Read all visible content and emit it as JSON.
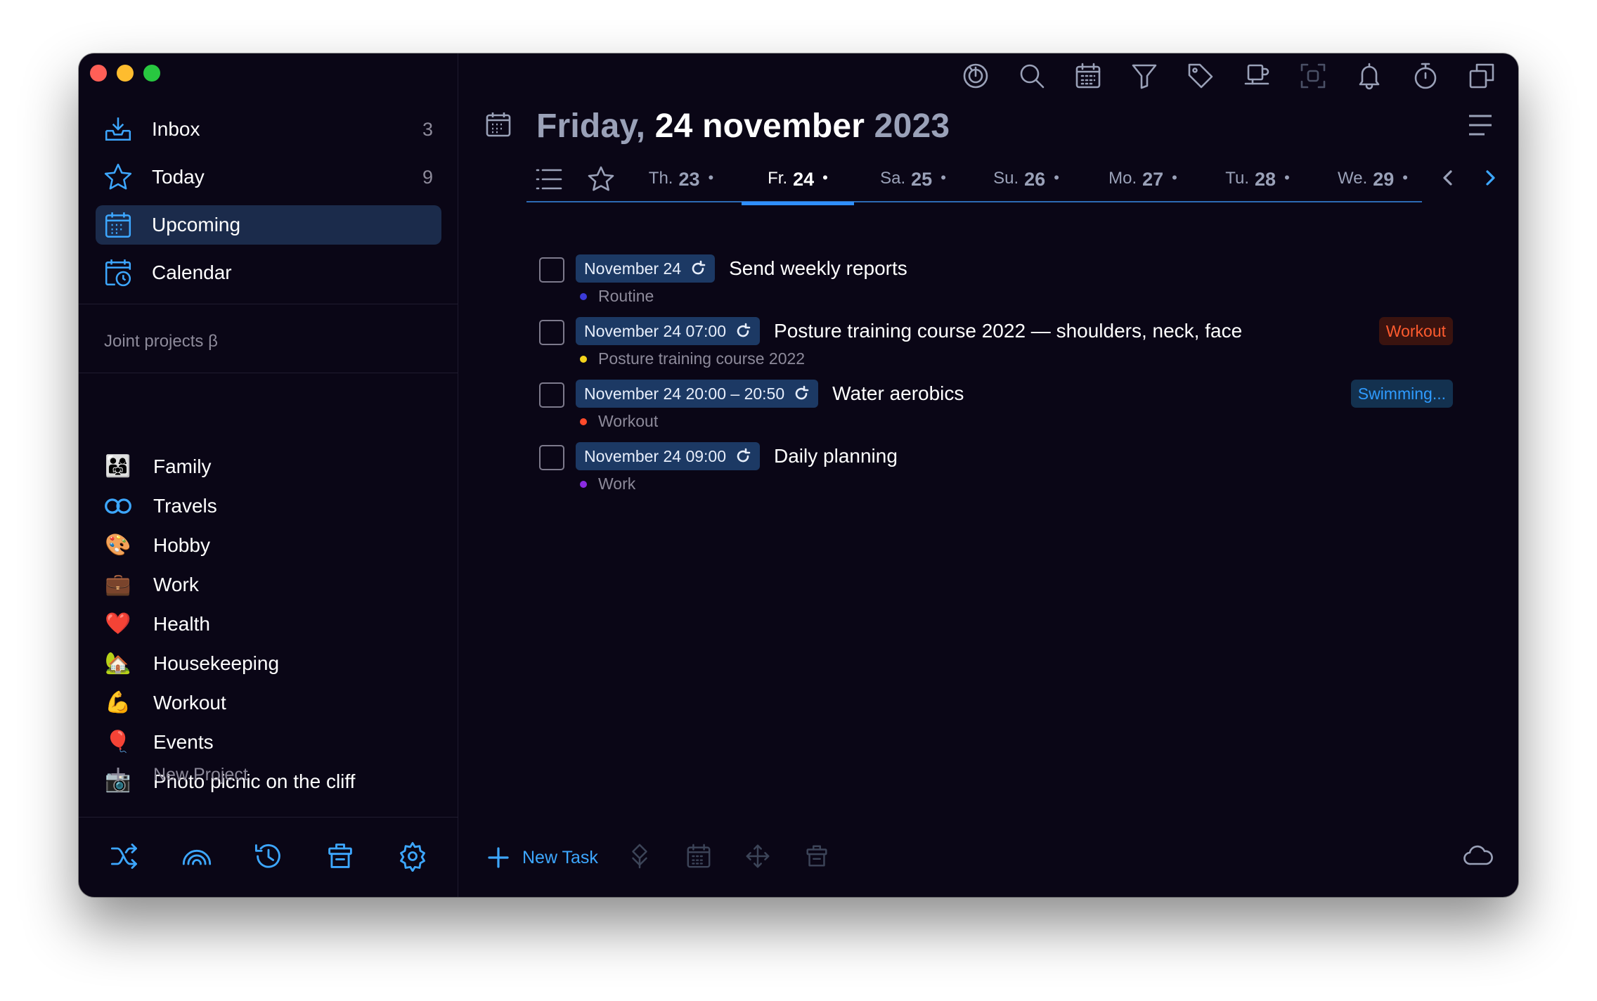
{
  "colors": {
    "accent": "#3da7ff",
    "window_bg": "#0a0616",
    "active_bg": "#1b2b4b",
    "pill_bg": "#1c3964",
    "muted_text": "#8d8a9a",
    "tag_workout": "#ff5b2e",
    "tag_swimming": "#2f9bff"
  },
  "sidebar": {
    "nav": [
      {
        "label": "Inbox",
        "count": "3",
        "icon": "inbox-icon"
      },
      {
        "label": "Today",
        "count": "9",
        "icon": "star-icon"
      },
      {
        "label": "Upcoming",
        "count": "",
        "icon": "calendar-grid-icon",
        "active": true
      },
      {
        "label": "Calendar",
        "count": "",
        "icon": "calendar-clock-icon"
      }
    ],
    "section_title": "Joint projects β",
    "projects": [
      {
        "label": "Family",
        "emoji": "👨‍👩‍👧"
      },
      {
        "label": "Travels",
        "emoji": "∞"
      },
      {
        "label": "Hobby",
        "emoji": "🎨"
      },
      {
        "label": "Work",
        "emoji": "💼"
      },
      {
        "label": "Health",
        "emoji": "❤️"
      },
      {
        "label": "Housekeeping",
        "emoji": "🏡"
      },
      {
        "label": "Workout",
        "emoji": "💪"
      },
      {
        "label": "Events",
        "emoji": "🎈"
      },
      {
        "label": "Photo picnic on the cliff",
        "emoji": "📷"
      }
    ],
    "new_project_label": "New Project",
    "toolbar_icons": [
      "shuffle-icon",
      "rainbow-icon",
      "history-icon",
      "trash-icon",
      "settings-icon"
    ]
  },
  "toolbar_icons": [
    "focus-icon",
    "search-icon",
    "calendar-icon",
    "filter-icon",
    "tag-icon",
    "coffee-icon",
    "scan-icon",
    "bell-icon",
    "timer-icon",
    "copy-icon"
  ],
  "header": {
    "weekday": "Friday,",
    "date": "24 november",
    "year": "2023"
  },
  "days": [
    {
      "prefix": "Th.",
      "num": "23",
      "dot": "•"
    },
    {
      "prefix": "Fr.",
      "num": "24",
      "dot": "•",
      "active": true
    },
    {
      "prefix": "Sa.",
      "num": "25",
      "dot": "•"
    },
    {
      "prefix": "Su.",
      "num": "26",
      "dot": "•"
    },
    {
      "prefix": "Mo.",
      "num": "27",
      "dot": "•"
    },
    {
      "prefix": "Tu.",
      "num": "28",
      "dot": "•"
    },
    {
      "prefix": "We.",
      "num": "29",
      "dot": "•"
    }
  ],
  "tasks": [
    {
      "date": "November 24",
      "title": "Send weekly reports",
      "project": "Routine",
      "project_color": "#3b3bd9",
      "tag": ""
    },
    {
      "date": "November 24 07:00",
      "title": "Posture training course 2022 — shoulders, neck, face",
      "project": "Posture training course 2022",
      "project_color": "#f4d31c",
      "tag": "Workout",
      "tag_kind": "workout"
    },
    {
      "date": "November 24 20:00 – 20:50",
      "title": "Water aerobics",
      "project": "Workout",
      "project_color": "#ff4a2b",
      "tag": "Swimming...",
      "tag_kind": "swim"
    },
    {
      "date": "November 24 09:00",
      "title": "Daily planning",
      "project": "Work",
      "project_color": "#8a2be2",
      "tag": ""
    }
  ],
  "bottom": {
    "new_task_label": "New Task",
    "icons": [
      "priority-icon",
      "calendar-icon",
      "move-icon",
      "trash-icon"
    ],
    "sync_icon": "cloud-icon"
  }
}
